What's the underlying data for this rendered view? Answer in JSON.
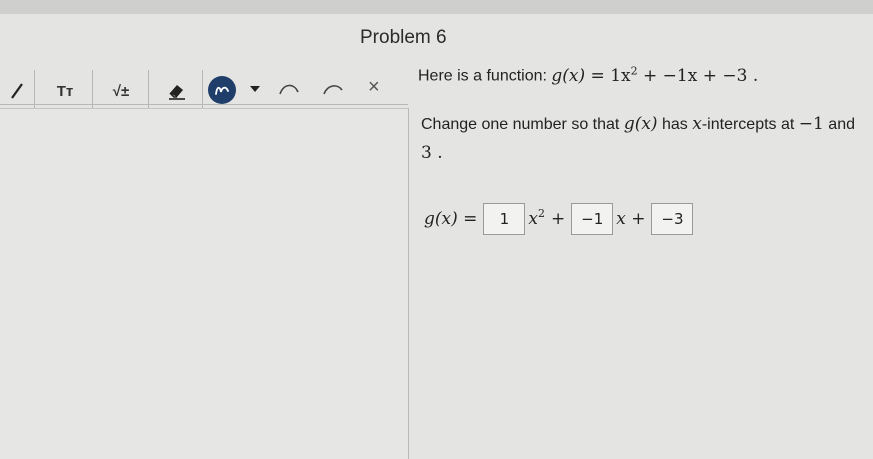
{
  "header": {
    "title": "Problem 6"
  },
  "toolbar": {
    "text_tool_label": "Tт",
    "math_tool_label": "√±",
    "close_glyph": "×",
    "tools": [
      {
        "name": "pen-tool",
        "icon": "pencil-icon"
      },
      {
        "name": "text-tool",
        "icon": "text-size-icon"
      },
      {
        "name": "math-tool",
        "icon": "sqrt-plus-minus-icon"
      },
      {
        "name": "eraser-tool",
        "icon": "eraser-icon"
      },
      {
        "name": "draw-color",
        "icon": "scribble-icon",
        "color": "#1f3f6a"
      },
      {
        "name": "undo",
        "icon": "undo-curve-icon"
      },
      {
        "name": "redo",
        "icon": "redo-curve-icon"
      },
      {
        "name": "close",
        "icon": "close-icon"
      }
    ]
  },
  "problem": {
    "prompt_text": "Here is a function:",
    "function_lhs": "g(x) =",
    "function_a": "1x",
    "function_mid": "+ −1x + −3 .",
    "instruction_line1": "Change one number so that",
    "instruction_gx": "g(x)",
    "instruction_part2": "has",
    "instruction_x": "x",
    "instruction_part3": "-intercepts at",
    "instruction_val1": "−1",
    "instruction_and": "and",
    "instruction_val2": "3 ."
  },
  "answer": {
    "lhs": "g(x) =",
    "coef_a": "1",
    "x2_label": "x",
    "exp": "2",
    "plus1": "+",
    "coef_b": "−1",
    "x_label": "x +",
    "coef_c": "−3"
  }
}
